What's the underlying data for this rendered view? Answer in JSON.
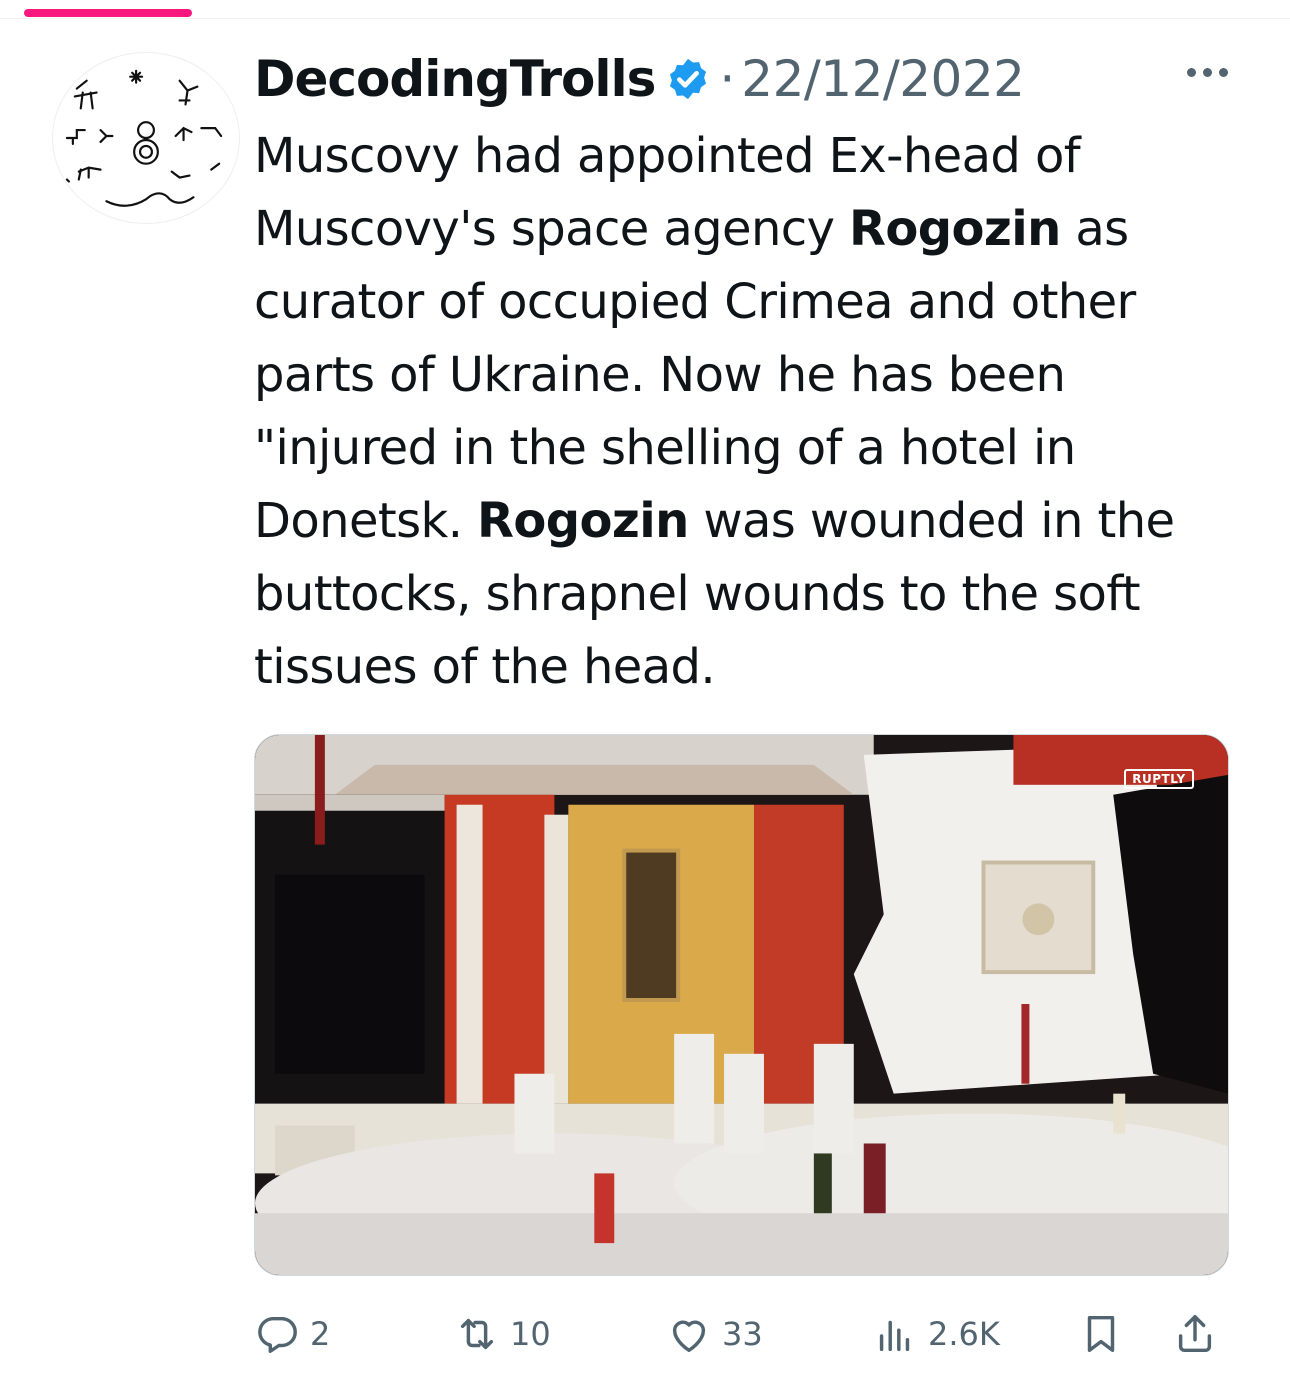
{
  "tweet": {
    "author_name": "DecodingTrolls",
    "separator": "·",
    "date": "22/12/2022",
    "text_parts": [
      "Muscovy had appointed Ex-head of Muscovy's space agency ",
      "Rogozin",
      " as curator of occupied Crimea and other parts of Ukraine. Now he has been \"injured in the shelling of a hotel in Donetsk. ",
      "Rogozin",
      " was wounded in the buttocks, shrapnel wounds to the soft tissues of the head."
    ],
    "media_watermark": "RUPTLY"
  },
  "actions": {
    "replies": "2",
    "retweets": "10",
    "likes": "33",
    "views": "2.6K"
  },
  "icons": {
    "verified": "verified-badge-icon",
    "more": "more-dots-icon",
    "reply": "reply-icon",
    "retweet": "retweet-icon",
    "like": "heart-icon",
    "views": "views-bar-chart-icon",
    "bookmark": "bookmark-icon",
    "share": "share-icon"
  },
  "colors": {
    "accent_pink": "#f91880",
    "verified_blue": "#1d9bf0",
    "muted_text": "#536471",
    "primary_text": "#0f1419"
  }
}
